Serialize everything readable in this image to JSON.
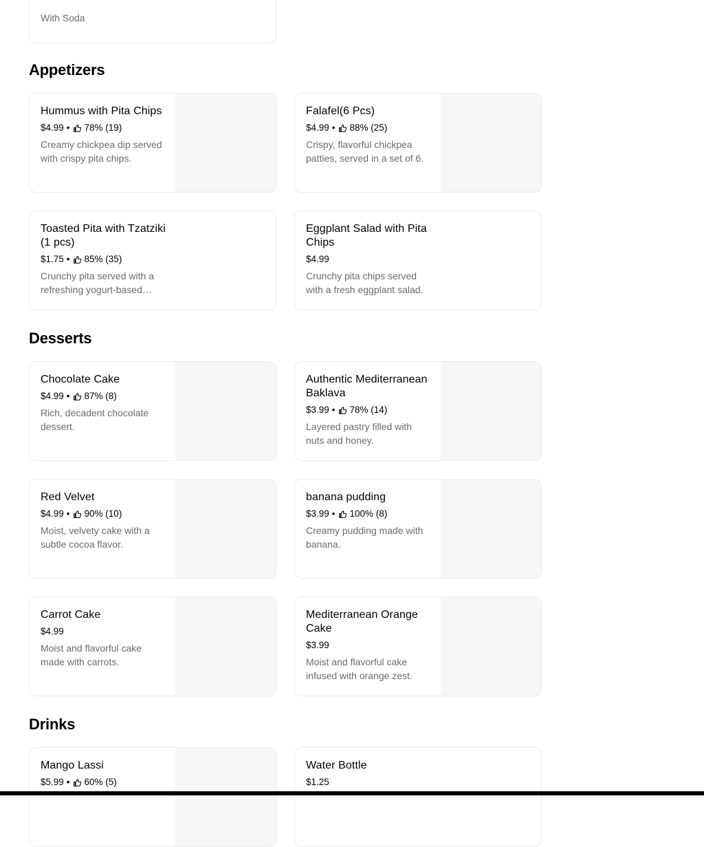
{
  "top_card": {
    "desc": "With Soda"
  },
  "sections": [
    {
      "title": "Appetizers",
      "items": [
        {
          "title": "Hummus with Pita Chips",
          "price": "$4.99",
          "rating": "78% (19)",
          "desc": "Creamy chickpea dip served with crispy pita chips."
        },
        {
          "title": "Falafel(6 Pcs)",
          "price": "$4.99",
          "rating": "88% (25)",
          "desc": "Crispy, flavorful chickpea patties, served in a set of 6."
        },
        {
          "title": "Toasted Pita with Tzatziki (1 pcs)",
          "price": "$1.75",
          "rating": "85% (35)",
          "desc": "Crunchy pita served with a refreshing yogurt-based…"
        },
        {
          "title": "Eggplant Salad with Pita Chips",
          "price": "$4.99",
          "rating": "",
          "desc": "Crunchy pita chips served with a fresh eggplant salad."
        }
      ]
    },
    {
      "title": "Desserts",
      "items": [
        {
          "title": "Chocolate Cake",
          "price": "$4.99",
          "rating": "87% (8)",
          "desc": "Rich, decadent chocolate dessert."
        },
        {
          "title": "Authentic Mediterranean Baklava",
          "price": "$3.99",
          "rating": "78% (14)",
          "desc": "Layered pastry filled with nuts and honey."
        },
        {
          "title": "Red Velvet",
          "price": "$4.99",
          "rating": "90% (10)",
          "desc": "Moist, velvety cake with a subtle cocoa flavor."
        },
        {
          "title": "banana pudding",
          "price": "$3.99",
          "rating": "100% (8)",
          "desc": "Creamy pudding made with banana."
        },
        {
          "title": "Carrot Cake",
          "price": "$4.99",
          "rating": "",
          "desc": "Moist and flavorful cake made with carrots."
        },
        {
          "title": "Mediterranean Orange Cake",
          "price": "$3.99",
          "rating": "",
          "desc": "Moist and flavorful cake infused with orange zest."
        }
      ]
    },
    {
      "title": "Drinks",
      "items": [
        {
          "title": "Mango Lassi",
          "price": "$5.99",
          "rating": "60% (5)",
          "desc": ""
        },
        {
          "title": "Water Bottle",
          "price": "$1.25",
          "rating": "",
          "desc": ""
        }
      ]
    }
  ],
  "colors": {
    "description": "#6b6b6b",
    "thumb_bg": "#f7f7f7",
    "card_border": "#ececec"
  },
  "icons": {
    "rating": "thumbs-up-icon"
  }
}
